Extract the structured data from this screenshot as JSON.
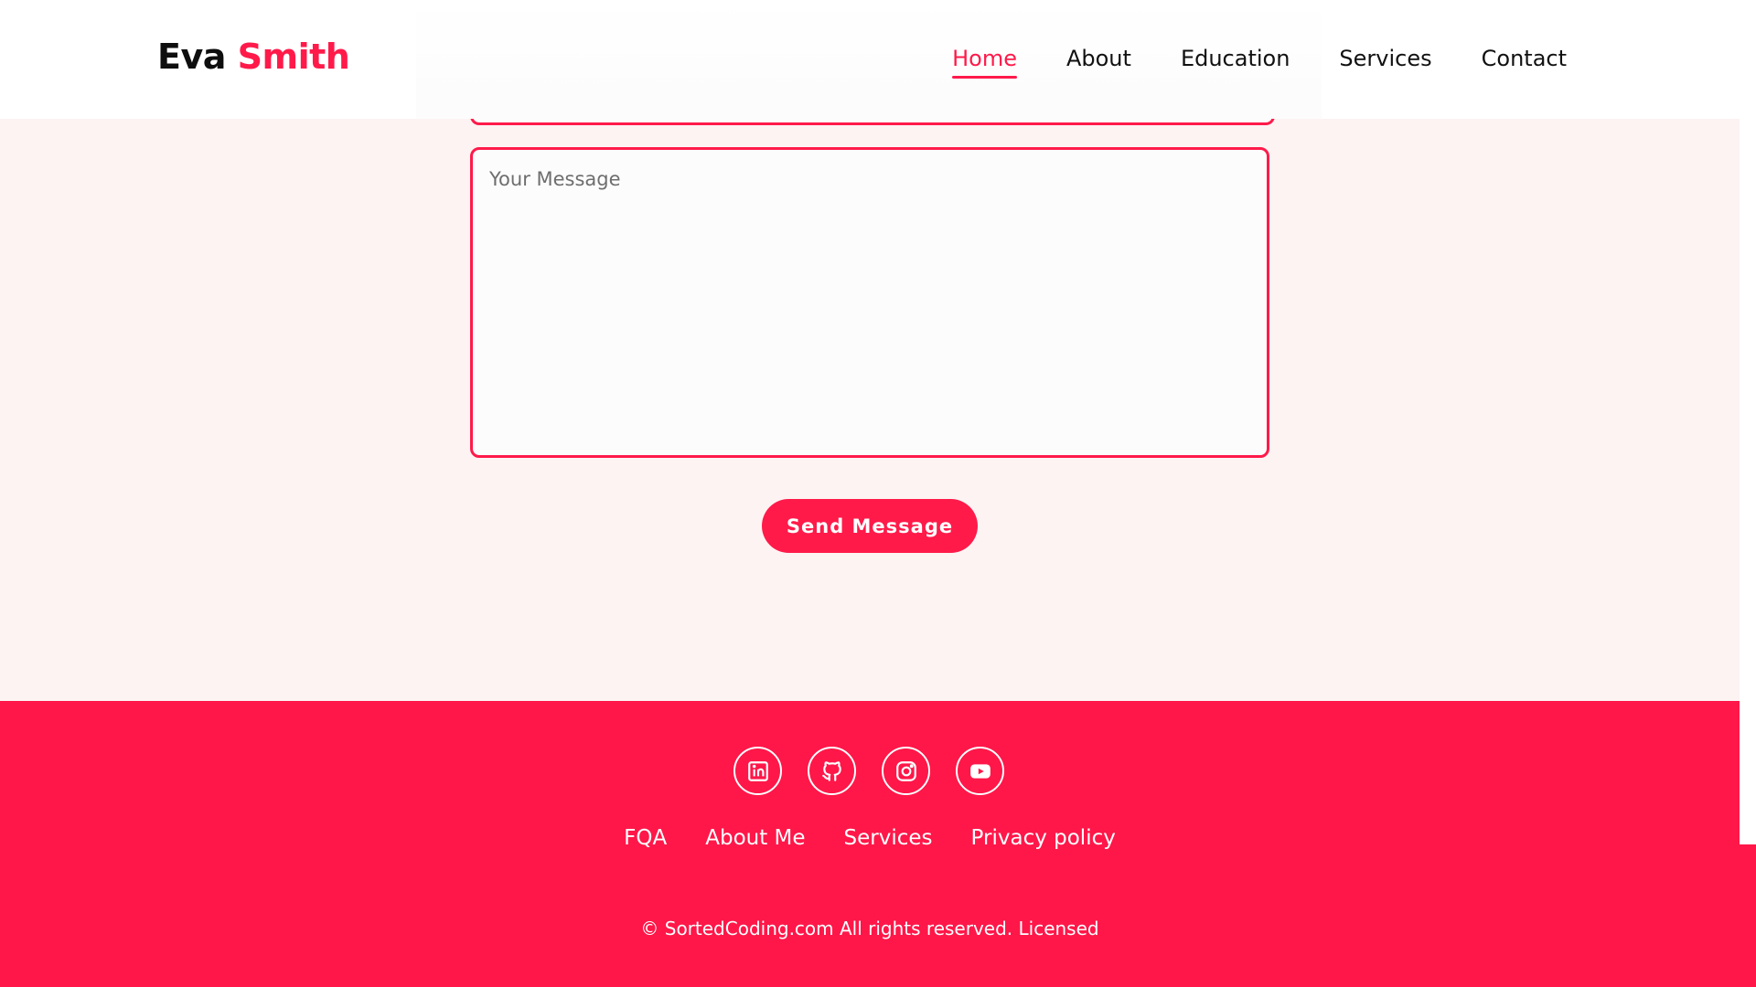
{
  "brand": {
    "first": "Eva",
    "last": "Smith",
    "accent_color": "#ff1a4a"
  },
  "nav": {
    "items": [
      {
        "label": "Home",
        "active": true
      },
      {
        "label": "About"
      },
      {
        "label": "Education"
      },
      {
        "label": "Services"
      },
      {
        "label": "Contact"
      }
    ]
  },
  "contact_form": {
    "message_placeholder": "Your Message",
    "message_value": "",
    "submit_label": "Send Message"
  },
  "footer": {
    "background_color": "#ff1749",
    "social_icons": [
      "linkedin-icon",
      "github-icon",
      "instagram-icon",
      "youtube-icon"
    ],
    "links": [
      "FQA",
      "About Me",
      "Services",
      "Privacy policy"
    ],
    "copyright": "© SortedCoding.com All rights reserved. Licensed"
  }
}
